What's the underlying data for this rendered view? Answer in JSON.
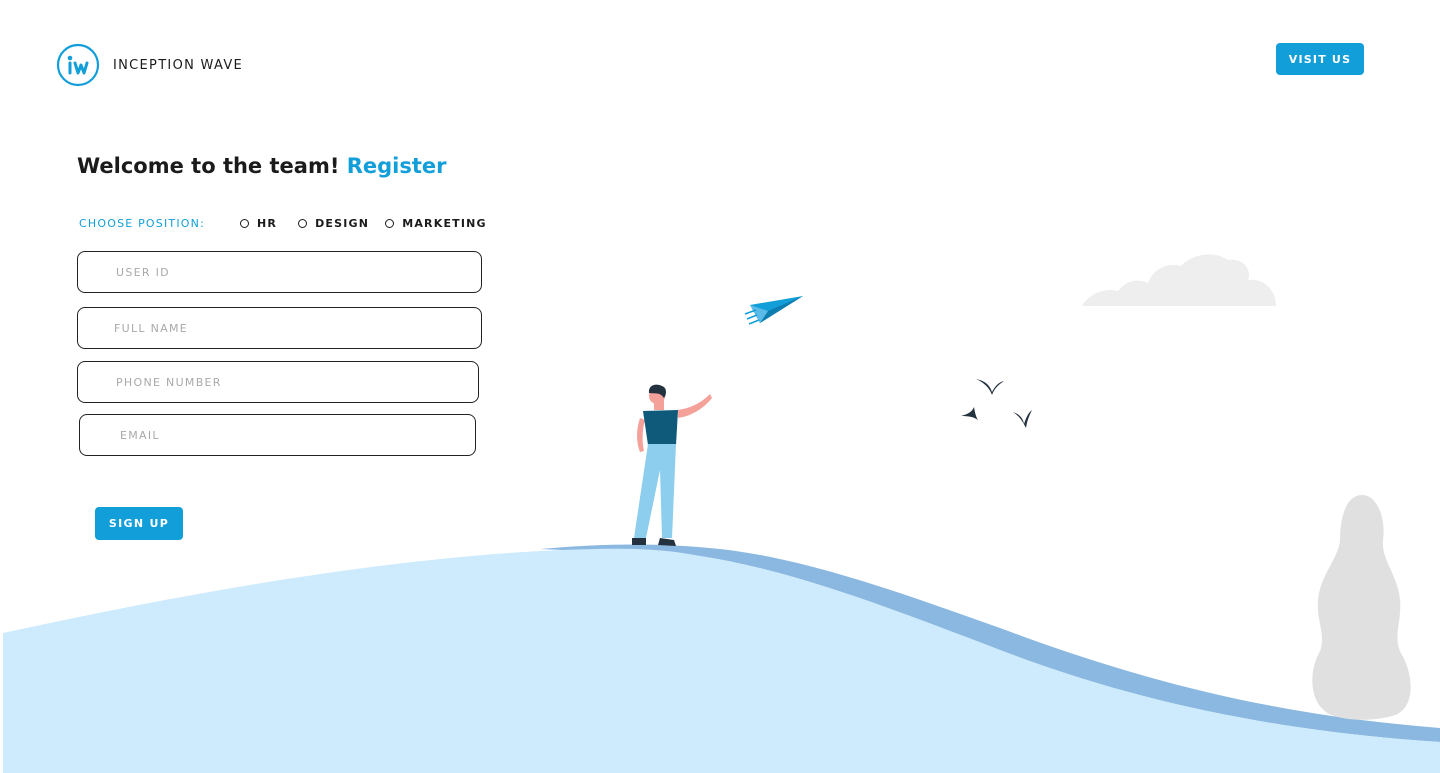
{
  "brand": {
    "name": "INCEPTION WAVE",
    "logo_letters": "iw",
    "color": "#129ed9"
  },
  "header": {
    "visit_label": "VISIT US"
  },
  "form": {
    "heading": "Welcome to the team!",
    "heading_accent": "Register",
    "position_label": "CHOOSE POSITION:",
    "positions": [
      "HR",
      "DESIGN",
      "MARKETING"
    ],
    "fields": {
      "user_id": {
        "placeholder": "USER ID",
        "value": ""
      },
      "full_name": {
        "placeholder": "FULL NAME",
        "value": ""
      },
      "phone": {
        "placeholder": "PHONE NUMBER",
        "value": ""
      },
      "email": {
        "placeholder": "EMAIL",
        "value": ""
      }
    },
    "signup_label": "SIGN UP"
  },
  "illustration": {
    "icons": [
      "paper-plane-icon",
      "bird-icon",
      "cloud-icon",
      "bush-icon",
      "person-figure"
    ],
    "colors": {
      "hill": "#cdebfc",
      "hill_shadow": "#8bb8e0",
      "cloud": "#eeeeee",
      "bush": "#e0e0e0",
      "shirt": "#0f5a7a",
      "pants": "#8dcdee"
    }
  }
}
